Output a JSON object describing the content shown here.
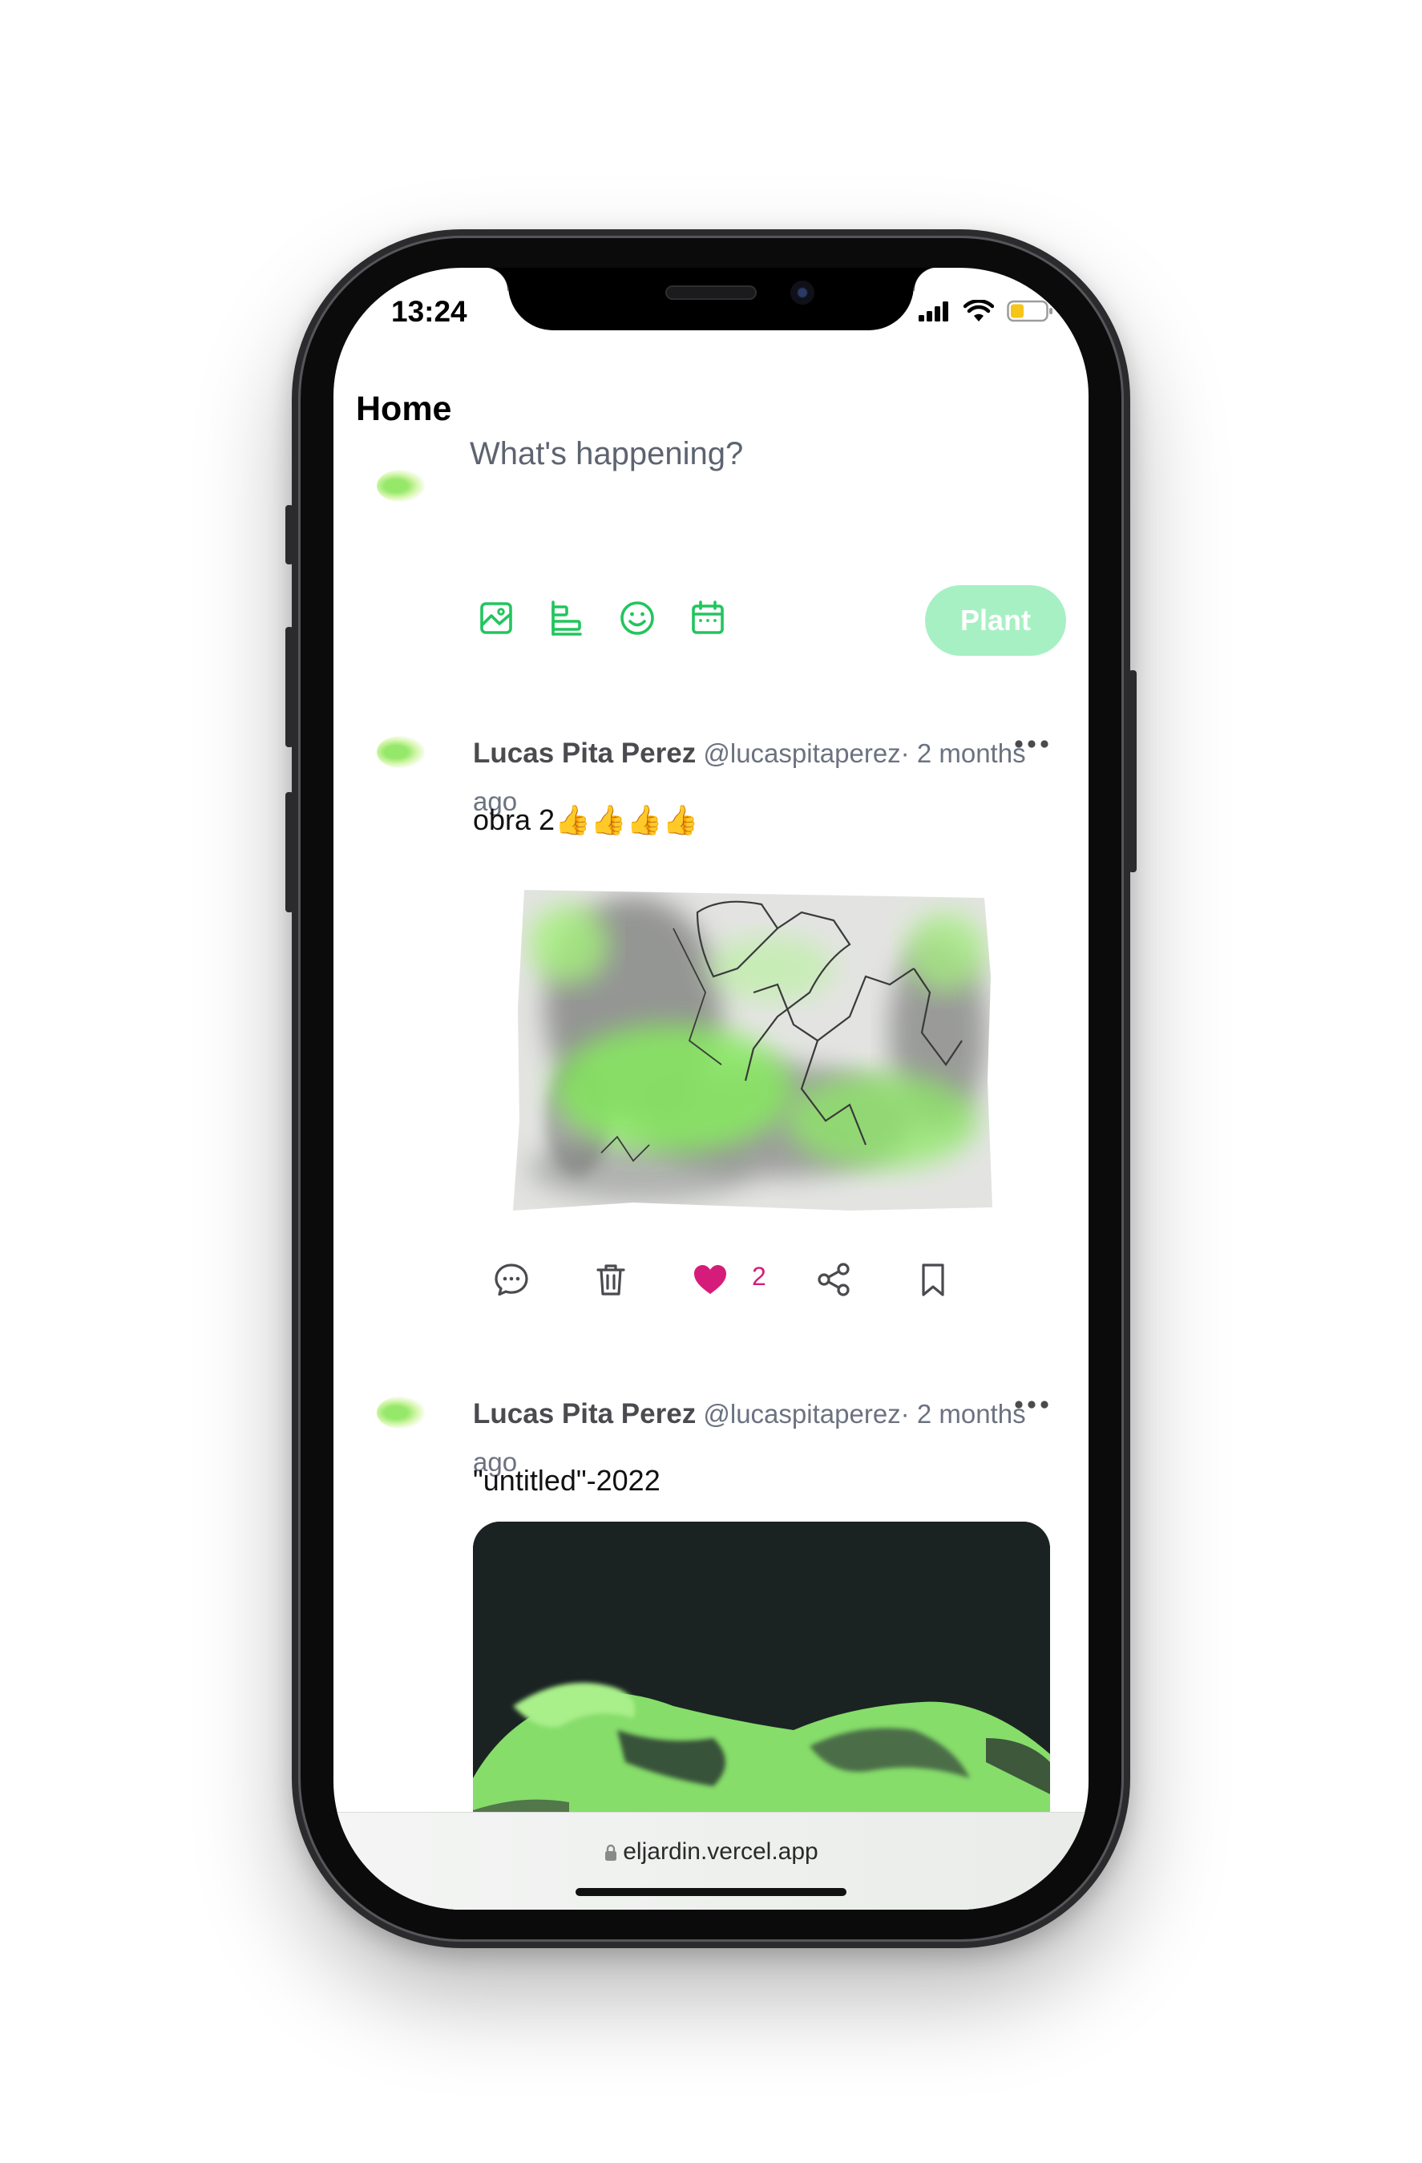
{
  "status_bar": {
    "time": "13:24"
  },
  "header": {
    "title": "Home"
  },
  "composer": {
    "placeholder": "What's happening?",
    "tools": [
      "image-icon",
      "align-icon",
      "emoji-icon",
      "calendar-icon"
    ],
    "submit_label": "Plant"
  },
  "posts": [
    {
      "author": "Lucas Pita Perez",
      "handle": "@lucaspitaperez",
      "time": "· 2 months ago",
      "text": "obra 2👍👍👍👍",
      "likes": "2"
    },
    {
      "author": "Lucas Pita Perez",
      "handle": "@lucaspitaperez",
      "time": "· 2 months ago",
      "text": "\"untitled\"-2022"
    }
  ],
  "browser": {
    "url": "eljardin.vercel.app"
  },
  "colors": {
    "accent_green": "#22c55e",
    "plant_button": "#a7f0c3",
    "like_pink": "#d61c7a"
  }
}
